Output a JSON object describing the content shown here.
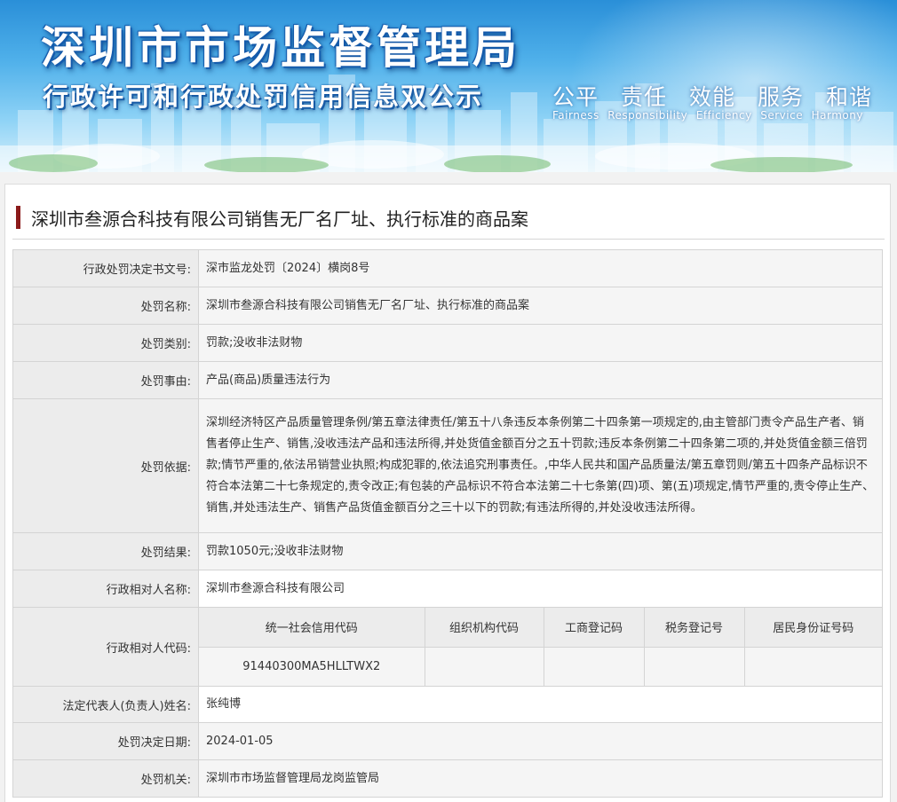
{
  "banner": {
    "title": "深圳市市场监督管理局",
    "subtitle": "行政许可和行政处罚信用信息双公示",
    "motto": [
      "公平",
      "责任",
      "效能",
      "服务",
      "和谐"
    ],
    "motto_en": [
      "Fairness",
      "Responsibility",
      "Efficiency",
      "Service",
      "Harmony"
    ]
  },
  "case": {
    "title": "深圳市叁源合科技有限公司销售无厂名厂址、执行标准的商品案"
  },
  "fields": {
    "decision_no": {
      "label": "行政处罚决定书文号:",
      "value": "深市监龙处罚〔2024〕横岗8号"
    },
    "penalty_name": {
      "label": "处罚名称:",
      "value": "深圳市叁源合科技有限公司销售无厂名厂址、执行标准的商品案"
    },
    "penalty_type": {
      "label": "处罚类别:",
      "value": "罚款;没收非法财物"
    },
    "penalty_reason": {
      "label": "处罚事由:",
      "value": "产品(商品)质量违法行为"
    },
    "penalty_basis": {
      "label": "处罚依据:",
      "value": "深圳经济特区产品质量管理条例/第五章法律责任/第五十八条违反本条例第二十四条第一项规定的,由主管部门责令产品生产者、销售者停止生产、销售,没收违法产品和违法所得,并处货值金额百分之五十罚款;违反本条例第二十四条第二项的,并处货值金额三倍罚款;情节严重的,依法吊销营业执照;构成犯罪的,依法追究刑事责任。,中华人民共和国产品质量法/第五章罚则/第五十四条产品标识不符合本法第二十七条规定的,责令改正;有包装的产品标识不符合本法第二十七条第(四)项、第(五)项规定,情节严重的,责令停止生产、销售,并处违法生产、销售产品货值金额百分之三十以下的罚款;有违法所得的,并处没收违法所得。"
    },
    "penalty_result": {
      "label": "处罚结果:",
      "value": "罚款1050元;没收非法财物"
    },
    "counterparty_name": {
      "label": "行政相对人名称:",
      "value": "深圳市叁源合科技有限公司"
    },
    "counterparty_code": {
      "label": "行政相对人代码:",
      "headers": [
        "统一社会信用代码",
        "组织机构代码",
        "工商登记码",
        "税务登记号",
        "居民身份证号码"
      ],
      "values": [
        "91440300MA5HLLTWX2",
        "",
        "",
        "",
        ""
      ]
    },
    "legal_rep": {
      "label": "法定代表人(负责人)姓名:",
      "value": "张纯博"
    },
    "decision_date": {
      "label": "处罚决定日期:",
      "value": "2024-01-05"
    },
    "authority": {
      "label": "处罚机关:",
      "value": "深圳市市场监督管理局龙岗监管局"
    }
  }
}
